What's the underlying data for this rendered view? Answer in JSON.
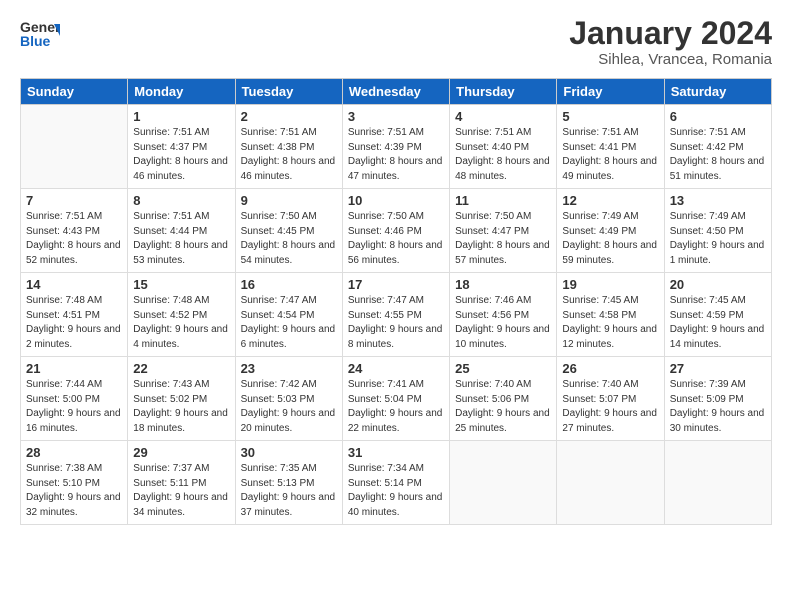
{
  "logo": {
    "general": "General",
    "blue": "Blue"
  },
  "title": "January 2024",
  "subtitle": "Sihlea, Vrancea, Romania",
  "headers": [
    "Sunday",
    "Monday",
    "Tuesday",
    "Wednesday",
    "Thursday",
    "Friday",
    "Saturday"
  ],
  "weeks": [
    [
      {
        "day": "",
        "sunrise": "",
        "sunset": "",
        "daylight": ""
      },
      {
        "day": "1",
        "sunrise": "Sunrise: 7:51 AM",
        "sunset": "Sunset: 4:37 PM",
        "daylight": "Daylight: 8 hours and 46 minutes."
      },
      {
        "day": "2",
        "sunrise": "Sunrise: 7:51 AM",
        "sunset": "Sunset: 4:38 PM",
        "daylight": "Daylight: 8 hours and 46 minutes."
      },
      {
        "day": "3",
        "sunrise": "Sunrise: 7:51 AM",
        "sunset": "Sunset: 4:39 PM",
        "daylight": "Daylight: 8 hours and 47 minutes."
      },
      {
        "day": "4",
        "sunrise": "Sunrise: 7:51 AM",
        "sunset": "Sunset: 4:40 PM",
        "daylight": "Daylight: 8 hours and 48 minutes."
      },
      {
        "day": "5",
        "sunrise": "Sunrise: 7:51 AM",
        "sunset": "Sunset: 4:41 PM",
        "daylight": "Daylight: 8 hours and 49 minutes."
      },
      {
        "day": "6",
        "sunrise": "Sunrise: 7:51 AM",
        "sunset": "Sunset: 4:42 PM",
        "daylight": "Daylight: 8 hours and 51 minutes."
      }
    ],
    [
      {
        "day": "7",
        "sunrise": "Sunrise: 7:51 AM",
        "sunset": "Sunset: 4:43 PM",
        "daylight": "Daylight: 8 hours and 52 minutes."
      },
      {
        "day": "8",
        "sunrise": "Sunrise: 7:51 AM",
        "sunset": "Sunset: 4:44 PM",
        "daylight": "Daylight: 8 hours and 53 minutes."
      },
      {
        "day": "9",
        "sunrise": "Sunrise: 7:50 AM",
        "sunset": "Sunset: 4:45 PM",
        "daylight": "Daylight: 8 hours and 54 minutes."
      },
      {
        "day": "10",
        "sunrise": "Sunrise: 7:50 AM",
        "sunset": "Sunset: 4:46 PM",
        "daylight": "Daylight: 8 hours and 56 minutes."
      },
      {
        "day": "11",
        "sunrise": "Sunrise: 7:50 AM",
        "sunset": "Sunset: 4:47 PM",
        "daylight": "Daylight: 8 hours and 57 minutes."
      },
      {
        "day": "12",
        "sunrise": "Sunrise: 7:49 AM",
        "sunset": "Sunset: 4:49 PM",
        "daylight": "Daylight: 8 hours and 59 minutes."
      },
      {
        "day": "13",
        "sunrise": "Sunrise: 7:49 AM",
        "sunset": "Sunset: 4:50 PM",
        "daylight": "Daylight: 9 hours and 1 minute."
      }
    ],
    [
      {
        "day": "14",
        "sunrise": "Sunrise: 7:48 AM",
        "sunset": "Sunset: 4:51 PM",
        "daylight": "Daylight: 9 hours and 2 minutes."
      },
      {
        "day": "15",
        "sunrise": "Sunrise: 7:48 AM",
        "sunset": "Sunset: 4:52 PM",
        "daylight": "Daylight: 9 hours and 4 minutes."
      },
      {
        "day": "16",
        "sunrise": "Sunrise: 7:47 AM",
        "sunset": "Sunset: 4:54 PM",
        "daylight": "Daylight: 9 hours and 6 minutes."
      },
      {
        "day": "17",
        "sunrise": "Sunrise: 7:47 AM",
        "sunset": "Sunset: 4:55 PM",
        "daylight": "Daylight: 9 hours and 8 minutes."
      },
      {
        "day": "18",
        "sunrise": "Sunrise: 7:46 AM",
        "sunset": "Sunset: 4:56 PM",
        "daylight": "Daylight: 9 hours and 10 minutes."
      },
      {
        "day": "19",
        "sunrise": "Sunrise: 7:45 AM",
        "sunset": "Sunset: 4:58 PM",
        "daylight": "Daylight: 9 hours and 12 minutes."
      },
      {
        "day": "20",
        "sunrise": "Sunrise: 7:45 AM",
        "sunset": "Sunset: 4:59 PM",
        "daylight": "Daylight: 9 hours and 14 minutes."
      }
    ],
    [
      {
        "day": "21",
        "sunrise": "Sunrise: 7:44 AM",
        "sunset": "Sunset: 5:00 PM",
        "daylight": "Daylight: 9 hours and 16 minutes."
      },
      {
        "day": "22",
        "sunrise": "Sunrise: 7:43 AM",
        "sunset": "Sunset: 5:02 PM",
        "daylight": "Daylight: 9 hours and 18 minutes."
      },
      {
        "day": "23",
        "sunrise": "Sunrise: 7:42 AM",
        "sunset": "Sunset: 5:03 PM",
        "daylight": "Daylight: 9 hours and 20 minutes."
      },
      {
        "day": "24",
        "sunrise": "Sunrise: 7:41 AM",
        "sunset": "Sunset: 5:04 PM",
        "daylight": "Daylight: 9 hours and 22 minutes."
      },
      {
        "day": "25",
        "sunrise": "Sunrise: 7:40 AM",
        "sunset": "Sunset: 5:06 PM",
        "daylight": "Daylight: 9 hours and 25 minutes."
      },
      {
        "day": "26",
        "sunrise": "Sunrise: 7:40 AM",
        "sunset": "Sunset: 5:07 PM",
        "daylight": "Daylight: 9 hours and 27 minutes."
      },
      {
        "day": "27",
        "sunrise": "Sunrise: 7:39 AM",
        "sunset": "Sunset: 5:09 PM",
        "daylight": "Daylight: 9 hours and 30 minutes."
      }
    ],
    [
      {
        "day": "28",
        "sunrise": "Sunrise: 7:38 AM",
        "sunset": "Sunset: 5:10 PM",
        "daylight": "Daylight: 9 hours and 32 minutes."
      },
      {
        "day": "29",
        "sunrise": "Sunrise: 7:37 AM",
        "sunset": "Sunset: 5:11 PM",
        "daylight": "Daylight: 9 hours and 34 minutes."
      },
      {
        "day": "30",
        "sunrise": "Sunrise: 7:35 AM",
        "sunset": "Sunset: 5:13 PM",
        "daylight": "Daylight: 9 hours and 37 minutes."
      },
      {
        "day": "31",
        "sunrise": "Sunrise: 7:34 AM",
        "sunset": "Sunset: 5:14 PM",
        "daylight": "Daylight: 9 hours and 40 minutes."
      },
      {
        "day": "",
        "sunrise": "",
        "sunset": "",
        "daylight": ""
      },
      {
        "day": "",
        "sunrise": "",
        "sunset": "",
        "daylight": ""
      },
      {
        "day": "",
        "sunrise": "",
        "sunset": "",
        "daylight": ""
      }
    ]
  ]
}
